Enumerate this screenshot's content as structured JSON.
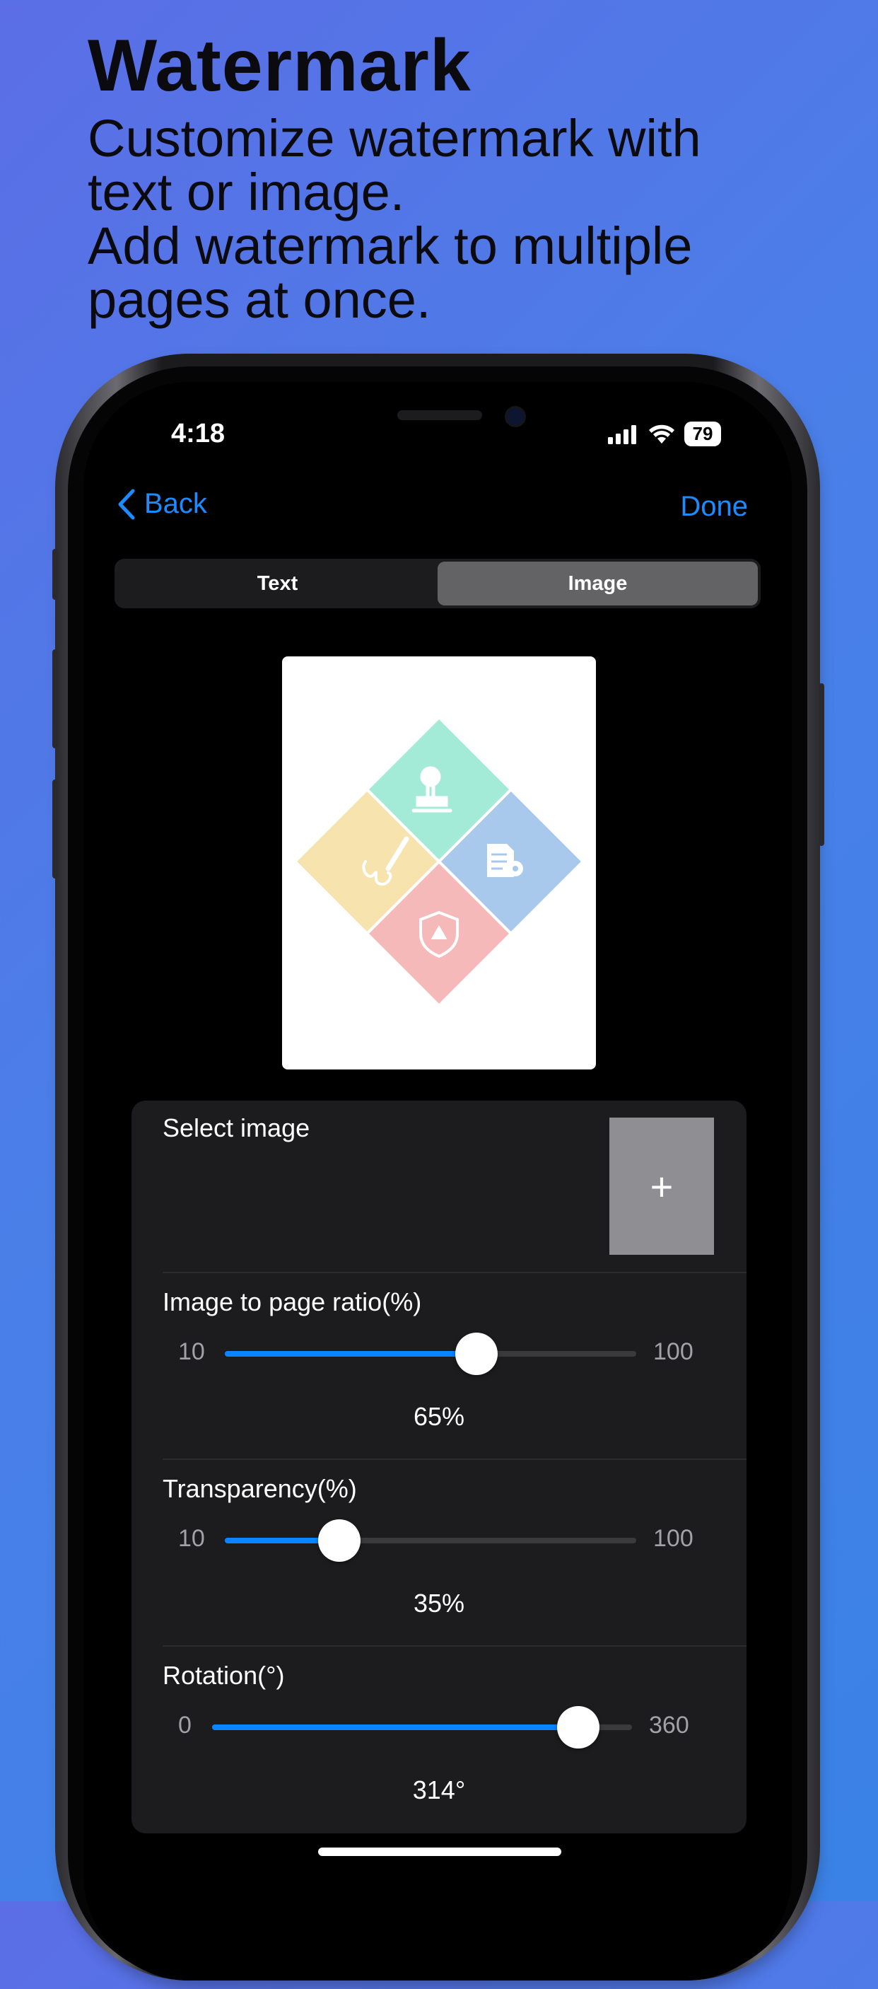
{
  "headline": {
    "title": "Watermark",
    "subtitle_lines": [
      "Customize watermark with",
      "text or image.",
      "Add watermark to multiple",
      "pages at once."
    ]
  },
  "status_bar": {
    "time": "4:18",
    "battery": "79"
  },
  "nav": {
    "back_label": "Back",
    "done_label": "Done"
  },
  "segments": [
    {
      "label": "Text",
      "selected": false
    },
    {
      "label": "Image",
      "selected": true
    }
  ],
  "select_image": {
    "label": "Select image",
    "add_symbol": "+"
  },
  "sliders": {
    "ratio": {
      "label": "Image to page ratio(%)",
      "min": "10",
      "max": "100",
      "value": 65,
      "value_text": "65%"
    },
    "transparency": {
      "label": "Transparency(%)",
      "min": "10",
      "max": "100",
      "value": 35,
      "value_text": "35%"
    },
    "rotation": {
      "label": "Rotation(°)",
      "min": "0",
      "max": "360",
      "value": 314,
      "value_text": "314°"
    }
  },
  "colors": {
    "accent": "#0a84ff",
    "tile_green": "#a3ead7",
    "tile_blue": "#a9c9ec",
    "tile_yellow": "#f6e3ad",
    "tile_red": "#f6b9b9"
  },
  "icons": [
    "chevron-left-icon",
    "signal-icon",
    "wifi-icon",
    "battery-icon",
    "stamp-icon",
    "document-gear-icon",
    "signature-pen-icon",
    "shield-icon",
    "plus-icon"
  ]
}
